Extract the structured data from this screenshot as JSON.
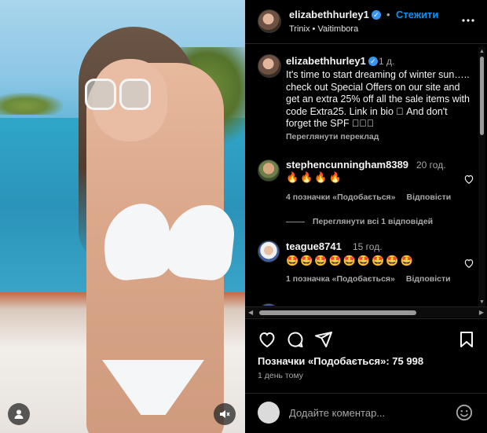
{
  "post": {
    "username": "elizabethhurley1",
    "follow_label": "Стежити",
    "location": "Trinix • Vaitimbora",
    "caption": {
      "username": "elizabethhurley1",
      "time": "1 д.",
      "text": "It's time to start dreaming of winter sun….. check out Special Offers on our site and get an extra 25% off all the sale items with code Extra25. Link in bio 􀀀 And don't forget the SPF 􀀀􀀀􀀀",
      "translate_label": "Переглянути переклад"
    },
    "comments": [
      {
        "username": "stephencunningham8389",
        "time": "20 год.",
        "text": "🔥🔥🔥🔥",
        "likes_label": "4 позначки «Подобається»",
        "reply_label": "Відповісти",
        "view_replies_label": "Переглянути всі 1 відповідей"
      },
      {
        "username": "teague8741",
        "time": "15 год.",
        "text": "🤩🤩🤩🤩🤩🤩🤩🤩🤩",
        "likes_label": "1 позначка «Подобається»",
        "reply_label": "Відповісти"
      }
    ],
    "likes": "Позначки «Подобається»: 75 998",
    "posted": "1 день тому",
    "composer_placeholder": "Додайте коментар..."
  },
  "icons": {
    "verified": "✓"
  },
  "colors": {
    "background": "#000000",
    "link": "#0095f6",
    "verified": "#3897f0",
    "muted_text": "#a8a8a8"
  }
}
